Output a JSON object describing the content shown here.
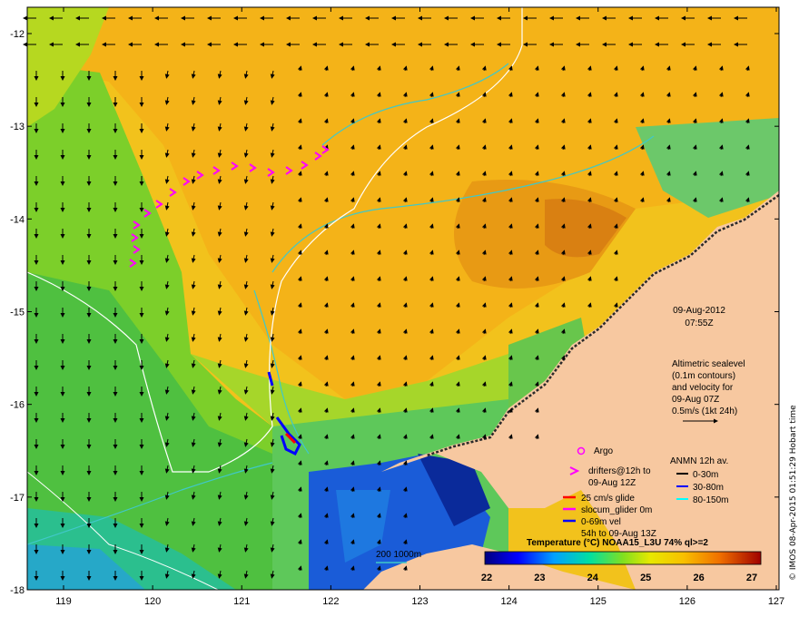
{
  "map": {
    "lon_ticks": [
      "119",
      "120",
      "121",
      "122",
      "123",
      "124",
      "125",
      "126",
      "127"
    ],
    "lat_ticks": [
      "-12",
      "-13",
      "-14",
      "-15",
      "-16",
      "-17",
      "-18"
    ],
    "date": "09-Aug-2012",
    "time": "07:55Z",
    "altimetry": {
      "line1": "Altimetric sealevel",
      "line2": "(0.1m contours)",
      "line3": "and velocity for",
      "line4": "09-Aug 07Z",
      "line5": "0.5m/s (1kt 24h)"
    },
    "legend": {
      "argo": "Argo",
      "drifters_line1": "drifters@12h to",
      "drifters_line2": "09-Aug 12Z",
      "glide": "25 cm/s glide",
      "slocum": "slocum_glider 0m",
      "vel_line1": "0-69m vel",
      "vel_line2": "54h to 09-Aug 13Z",
      "anmn_title": "ANMN 12h av.",
      "anmn_1": "0-30m",
      "anmn_2": "30-80m",
      "anmn_3": "80-150m"
    },
    "isobath_label": "200  1000m",
    "colorbar": {
      "title": "Temperature (°C) NOAA15_L3U 74% ql>=2",
      "ticks": [
        "22",
        "23",
        "24",
        "25",
        "26",
        "27"
      ]
    },
    "credit": "© IMOS 08-Apr-2015 01:51:29 Hobart time",
    "colors": {
      "land": "#f7c8a0",
      "shelf_land": "#7a7a7a",
      "drifter": "#ff00ff",
      "glider_red": "#ff0000",
      "glider_blue": "#0000ff",
      "anmn_black": "#000000",
      "anmn_blue": "#0000ff",
      "anmn_cyan": "#00ffff"
    }
  }
}
